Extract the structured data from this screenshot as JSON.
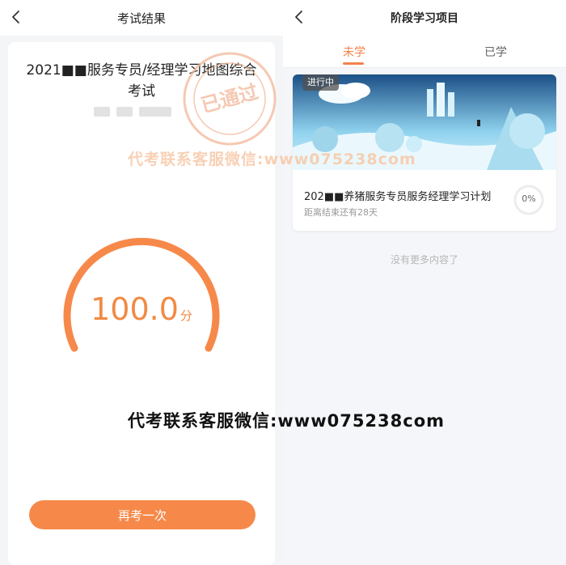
{
  "left": {
    "nav_title": "考试结果",
    "exam_title": "2021■■服务专员/经理学习地图综合考试",
    "stamp_text": "已通过",
    "score": "100.0",
    "score_unit": "分",
    "score_progress_pct": 100,
    "retry_label": "再考一次"
  },
  "right": {
    "nav_title": "阶段学习项目",
    "tabs": [
      {
        "label": "未学",
        "active": true
      },
      {
        "label": "已学",
        "active": false
      }
    ],
    "plan": {
      "badge": "进行中",
      "title": "202■■养猪服务专员服务经理学习计划",
      "subtitle": "距离结束还有28天",
      "progress": "0%"
    },
    "no_more": "没有更多内容了"
  },
  "watermark": {
    "top": "代考联系客服微信:www075238com",
    "bottom": "代考联系客服微信:www075238com"
  },
  "colors": {
    "accent": "#f2824b",
    "gauge": "#f6894a"
  }
}
